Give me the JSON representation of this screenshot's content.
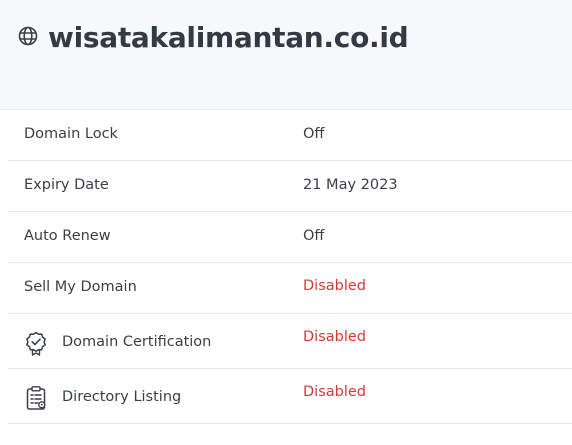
{
  "header": {
    "icon": "globe-icon",
    "domain": "wisatakalimantan.co.id"
  },
  "rows": [
    {
      "label": "Domain Lock",
      "value": "Off",
      "status": "normal"
    },
    {
      "label": "Expiry Date",
      "value": "21 May 2023",
      "status": "normal"
    },
    {
      "label": "Auto Renew",
      "value": "Off",
      "status": "normal"
    },
    {
      "label": "Sell My Domain",
      "value": "Disabled",
      "status": "disabled"
    },
    {
      "label": "Domain Certification",
      "value": "Disabled",
      "status": "disabled",
      "icon": "certificate-badge-icon"
    },
    {
      "label": "Directory Listing",
      "value": "Disabled",
      "status": "disabled",
      "icon": "clipboard-list-icon"
    }
  ],
  "colors": {
    "disabled": "#d43b36",
    "text": "#3a3f47",
    "title": "#333a44",
    "header_bg": "#f6f8fa"
  }
}
